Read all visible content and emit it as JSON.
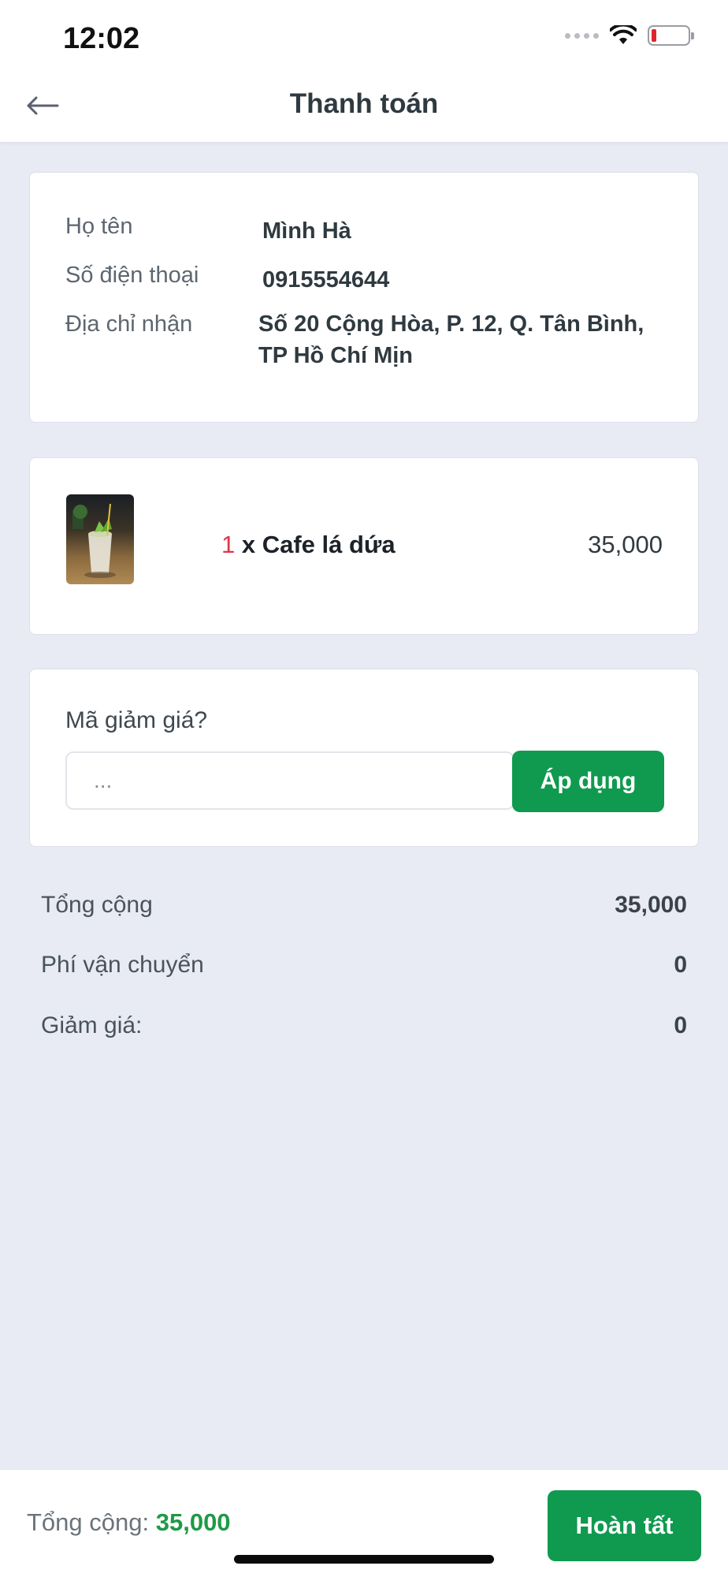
{
  "status_bar": {
    "time": "12:02"
  },
  "header": {
    "title": "Thanh toán",
    "back_icon": "arrow-left-icon"
  },
  "customer": {
    "name_label": "Họ tên",
    "name_value": "Mình Hà",
    "phone_label": "Số điện thoại",
    "phone_value": "0915554644",
    "address_label": "Địa chỉ nhận",
    "address_value": "Số 20 Cộng Hòa, P. 12, Q. Tân Bình, TP Hồ Chí Mịn"
  },
  "order_item": {
    "quantity": "1",
    "name": "x Cafe lá dứa",
    "price": "35,000"
  },
  "coupon": {
    "label": "Mã giảm giá?",
    "placeholder": "...",
    "apply_label": "Áp dụng"
  },
  "summary": {
    "subtotal_label": "Tổng cộng",
    "subtotal_value": "35,000",
    "shipping_label": "Phí vận chuyển",
    "shipping_value": "0",
    "discount_label": "Giảm giá:",
    "discount_value": "0"
  },
  "footer": {
    "total_label": "Tổng cộng:",
    "total_value": "35,000",
    "complete_label": "Hoàn tất"
  },
  "colors": {
    "accent": "#0f9a4f",
    "quantity": "#e0364a",
    "background": "#e8eaf4"
  }
}
